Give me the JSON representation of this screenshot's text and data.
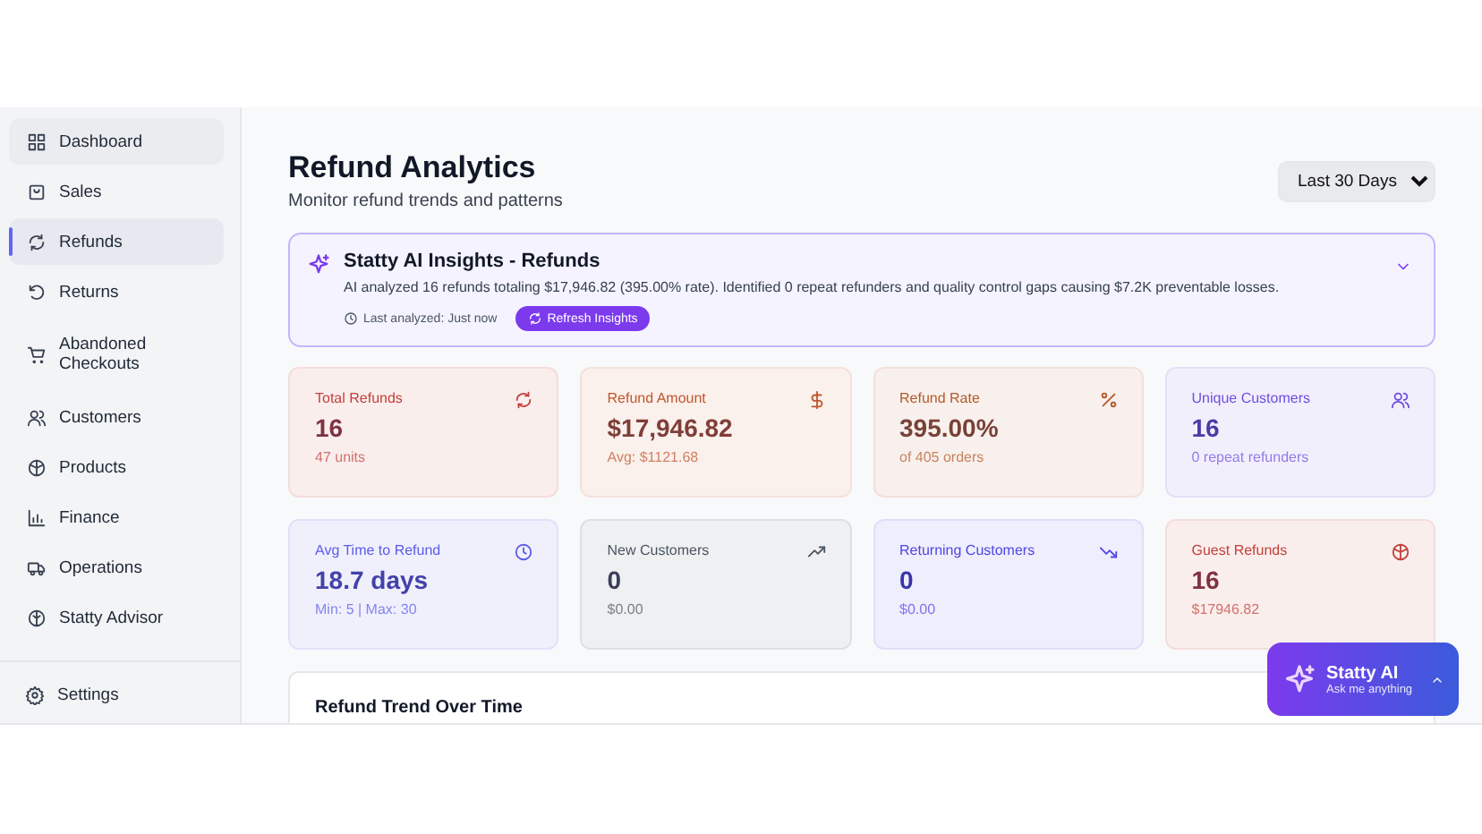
{
  "sidebar": {
    "items": [
      {
        "label": "Dashboard",
        "selected": false
      },
      {
        "label": "Sales",
        "selected": false
      },
      {
        "label": "Refunds",
        "selected": true
      },
      {
        "label": "Returns",
        "selected": false
      },
      {
        "label": "Abandoned Checkouts",
        "selected": false
      },
      {
        "label": "Customers",
        "selected": false
      },
      {
        "label": "Products",
        "selected": false
      },
      {
        "label": "Finance",
        "selected": false
      },
      {
        "label": "Operations",
        "selected": false
      },
      {
        "label": "Statty Advisor",
        "selected": false
      }
    ],
    "footer": {
      "label": "Settings"
    }
  },
  "header": {
    "title": "Refund Analytics",
    "subtitle": "Monitor refund trends and patterns",
    "period": "Last 30 Days"
  },
  "insights": {
    "title": "Statty AI Insights - Refunds",
    "summary": "AI analyzed 16 refunds totaling $17,946.82 (395.00% rate). Identified 0 repeat refunders and quality control gaps causing $7.2K preventable losses.",
    "last_analyzed": "Last analyzed: Just now",
    "button": "Refresh Insights"
  },
  "cards": [
    {
      "label": "Total Refunds",
      "value": "16",
      "detail": "47 units",
      "color": "#c2413b"
    },
    {
      "label": "Refund Amount",
      "value": "$17,946.82",
      "detail": "Avg: $1121.68",
      "color": "#c2562b"
    },
    {
      "label": "Refund Rate",
      "value": "395.00%",
      "detail": "of 405 orders",
      "color": "#b45a2a"
    },
    {
      "label": "Unique Customers",
      "value": "16",
      "detail": "0 repeat refunders",
      "color": "#6d4fe0"
    },
    {
      "label": "Avg Time to Refund",
      "value": "18.7 days",
      "detail": "Min: 5 | Max: 30",
      "color": "#5b5be8"
    },
    {
      "label": "New Customers",
      "value": "0",
      "detail": "$0.00",
      "color": "#4b5563"
    },
    {
      "label": "Returning Customers",
      "value": "0",
      "detail": "$0.00",
      "color": "#4f46e5"
    },
    {
      "label": "Guest Refunds",
      "value": "16",
      "detail": "$17946.82",
      "color": "#c2413b"
    }
  ],
  "trend": {
    "title": "Refund Trend Over Time"
  },
  "assistant": {
    "title": "Statty AI",
    "subtitle": "Ask me anything"
  }
}
